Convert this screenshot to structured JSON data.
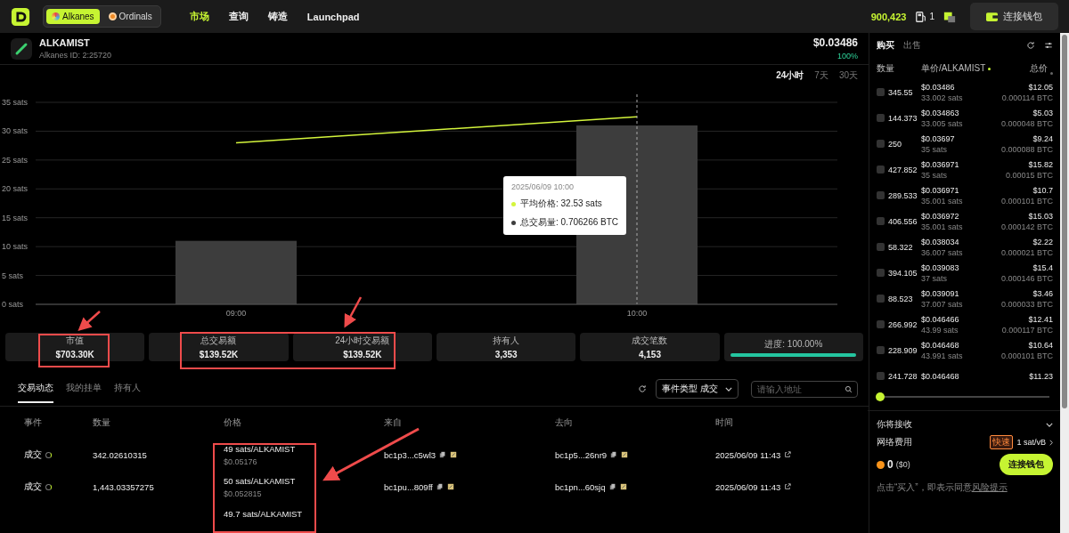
{
  "nav": {
    "networks": [
      {
        "label": "Alkanes",
        "selected": true
      },
      {
        "label": "Ordinals",
        "selected": false
      }
    ],
    "menu": [
      {
        "label": "市场",
        "selected": true
      },
      {
        "label": "查询",
        "selected": false
      },
      {
        "label": "铸造",
        "selected": false
      },
      {
        "label": "Launchpad",
        "selected": false
      }
    ],
    "points": "900,423",
    "gas_count": "1",
    "connect_button": "连接钱包"
  },
  "token": {
    "name": "ALKAMIST",
    "id": "Alkanes ID: 2:25720",
    "price": "$0.03486",
    "change": "100%"
  },
  "timeframes": [
    {
      "label": "24小时",
      "selected": true
    },
    {
      "label": "7天",
      "selected": false
    },
    {
      "label": "30天",
      "selected": false
    }
  ],
  "chart": {
    "chart_data": {
      "type": "bar",
      "categories": [
        "09:00",
        "10:00"
      ],
      "series": [
        {
          "name": "平均价格",
          "type": "line",
          "color": "#d4f53c",
          "values": [
            28,
            32.5
          ]
        },
        {
          "name": "总交易量",
          "type": "bar",
          "color": "#3d3d3d",
          "values": [
            11,
            31
          ]
        }
      ],
      "grid": true,
      "ref_lines": [
        {
          "axis": "x",
          "value": "10:00"
        }
      ],
      "ylim": [
        0,
        35
      ],
      "yticks": [
        {
          "value": 0,
          "label": "0 sats"
        },
        {
          "value": 5,
          "label": "5 sats"
        },
        {
          "value": 10,
          "label": "10 sats"
        },
        {
          "value": 15,
          "label": "15 sats"
        },
        {
          "value": 20,
          "label": "20 sats"
        },
        {
          "value": 25,
          "label": "25 sats"
        },
        {
          "value": 30,
          "label": "30 sats"
        },
        {
          "value": 35,
          "label": "35 sats"
        }
      ]
    },
    "tooltip": {
      "title": "2025/06/09 10:00",
      "values": [
        ": 32.53 sats",
        ": 0.706266 BTC"
      ]
    }
  },
  "stats": [
    {
      "kind": "stat",
      "label": "市值",
      "value": "$703.30K"
    },
    {
      "kind": "stat",
      "label": "总交易额",
      "value": "$139.52K"
    },
    {
      "kind": "stat",
      "label": "24小时交易额",
      "value": "$139.52K"
    },
    {
      "kind": "stat",
      "label": "持有人",
      "value": "3,353"
    },
    {
      "kind": "stat",
      "label": "成交笔数",
      "value": "4,153"
    },
    {
      "kind": "progress",
      "label": "进度: 100.00%",
      "level": 1
    }
  ],
  "activity": {
    "tabs": [
      {
        "label": "交易动态",
        "selected": true
      },
      {
        "label": "我的挂单",
        "selected": false
      },
      {
        "label": "持有人",
        "selected": false
      }
    ],
    "event_filter": {
      "label": "事件类型",
      "value": "成交"
    },
    "search": {
      "placeholder": "请输入地址"
    },
    "columns": [
      "事件",
      "数量",
      "价格",
      "来自",
      "去向",
      "时间"
    ],
    "rows": [
      {
        "event": "成交",
        "amount": "342.02610315",
        "price": "49 sats/ALKAMIST",
        "price_usd": "$0.05176",
        "from": "bc1p3...c5wl3",
        "to": "bc1p5...26nr9",
        "time": "2025/06/09 11:43"
      },
      {
        "event": "成交",
        "amount": "1,443.03357275",
        "price": "50 sats/ALKAMIST",
        "price_usd": "$0.052815",
        "from": "bc1pu...809ff",
        "to": "bc1pn...60sjq",
        "time": "2025/06/09 11:43"
      },
      {
        "price": "49.7 sats/ALKAMIST"
      }
    ]
  },
  "order_book": {
    "tabs": [
      {
        "label": "购买",
        "selected": true
      },
      {
        "label": "出售",
        "selected": false
      }
    ],
    "columns": [
      "数量",
      "单价/ALKAMIST",
      "总价"
    ],
    "rows": [
      {
        "amount": "345.55",
        "checked": false,
        "price_usd": "$0.03486",
        "price_sats": "33.002 sats",
        "total_usd": "$12.05",
        "total_btc": "0.000114 BTC"
      },
      {
        "amount": "144.373",
        "checked": false,
        "price_usd": "$0.034863",
        "price_sats": "33.005 sats",
        "total_usd": "$5.03",
        "total_btc": "0.000048 BTC"
      },
      {
        "amount": "250",
        "checked": false,
        "price_usd": "$0.03697",
        "price_sats": "35 sats",
        "total_usd": "$9.24",
        "total_btc": "0.000088 BTC"
      },
      {
        "amount": "427.852",
        "checked": false,
        "price_usd": "$0.036971",
        "price_sats": "35 sats",
        "total_usd": "$15.82",
        "total_btc": "0.00015 BTC"
      },
      {
        "amount": "289.533",
        "checked": false,
        "price_usd": "$0.036971",
        "price_sats": "35.001 sats",
        "total_usd": "$10.7",
        "total_btc": "0.000101 BTC"
      },
      {
        "amount": "406.556",
        "checked": false,
        "price_usd": "$0.036972",
        "price_sats": "35.001 sats",
        "total_usd": "$15.03",
        "total_btc": "0.000142 BTC"
      },
      {
        "amount": "58.322",
        "checked": false,
        "price_usd": "$0.038034",
        "price_sats": "36.007 sats",
        "total_usd": "$2.22",
        "total_btc": "0.000021 BTC"
      },
      {
        "amount": "394.105",
        "checked": false,
        "price_usd": "$0.039083",
        "price_sats": "37 sats",
        "total_usd": "$15.4",
        "total_btc": "0.000146 BTC"
      },
      {
        "amount": "88.523",
        "checked": false,
        "price_usd": "$0.039091",
        "price_sats": "37.007 sats",
        "total_usd": "$3.46",
        "total_btc": "0.000033 BTC"
      },
      {
        "amount": "266.992",
        "checked": false,
        "price_usd": "$0.046466",
        "price_sats": "43.99 sats",
        "total_usd": "$12.41",
        "total_btc": "0.000117 BTC"
      },
      {
        "amount": "228.909",
        "checked": false,
        "price_usd": "$0.046468",
        "price_sats": "43.991 sats",
        "total_usd": "$10.64",
        "total_btc": "0.000101 BTC"
      },
      {
        "amount": "241.728",
        "checked": false,
        "price_usd": "$0.046468",
        "total_usd": "$11.23"
      }
    ],
    "slider": {
      "level": 0
    },
    "receive_label": "你将接收",
    "fee": {
      "label": "网络费用",
      "speed": "快速",
      "rate": "1 sat/vB"
    },
    "amount": "0",
    "amount_usd": "($0)",
    "connect_button": "连接钱包",
    "note": {
      "text": "点击“买入”，即表示同意",
      "link": "风险提示"
    }
  }
}
